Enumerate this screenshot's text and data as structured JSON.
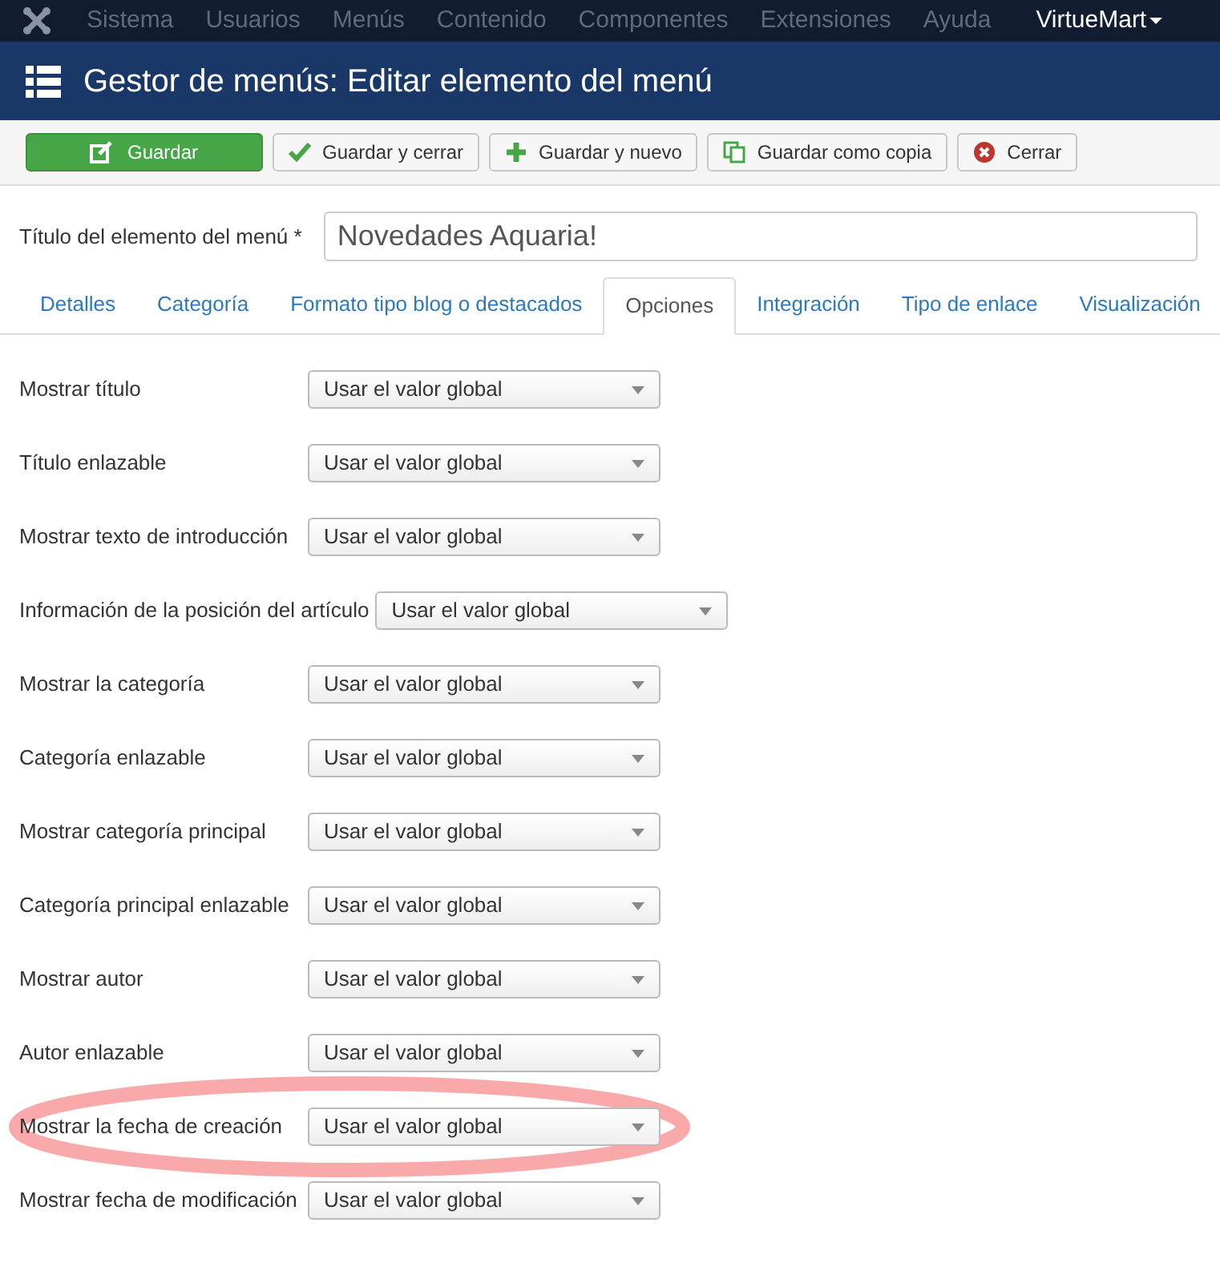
{
  "topnav": {
    "items": [
      "Sistema",
      "Usuarios",
      "Menús",
      "Contenido",
      "Componentes",
      "Extensiones",
      "Ayuda"
    ],
    "extra": "VirtueMart"
  },
  "header": {
    "title": "Gestor de menús: Editar elemento del menú"
  },
  "toolbar": [
    {
      "kind": "primary",
      "label": "Guardar"
    },
    {
      "kind": "default",
      "label": "Guardar y cerrar"
    },
    {
      "kind": "default",
      "label": "Guardar y nuevo"
    },
    {
      "kind": "default",
      "label": "Guardar como copia"
    },
    {
      "kind": "default",
      "label": "Cerrar"
    }
  ],
  "title_field": {
    "label": "Título del elemento del menú *",
    "value": "Novedades Aquaria!"
  },
  "tabs": [
    {
      "label": "Detalles",
      "selected": false
    },
    {
      "label": "Categoría",
      "selected": false
    },
    {
      "label": "Formato tipo blog o destacados",
      "selected": false
    },
    {
      "label": "Opciones",
      "selected": true
    },
    {
      "label": "Integración",
      "selected": false
    },
    {
      "label": "Tipo de enlace",
      "selected": false
    },
    {
      "label": "Visualización",
      "selected": false
    }
  ],
  "options": [
    {
      "label": "Mostrar título",
      "value": "Usar el valor global",
      "highlighted": false
    },
    {
      "label": "Título enlazable",
      "value": "Usar el valor global",
      "highlighted": false
    },
    {
      "label": "Mostrar texto de introducción",
      "value": "Usar el valor global",
      "highlighted": false
    },
    {
      "label": "Información de la posición del artículo",
      "value": "Usar el valor global",
      "highlighted": false
    },
    {
      "label": "Mostrar la categoría",
      "value": "Usar el valor global",
      "highlighted": false
    },
    {
      "label": "Categoría enlazable",
      "value": "Usar el valor global",
      "highlighted": false
    },
    {
      "label": "Mostrar categoría principal",
      "value": "Usar el valor global",
      "highlighted": false
    },
    {
      "label": "Categoría principal enlazable",
      "value": "Usar el valor global",
      "highlighted": false
    },
    {
      "label": "Mostrar autor",
      "value": "Usar el valor global",
      "highlighted": false
    },
    {
      "label": "Autor enlazable",
      "value": "Usar el valor global",
      "highlighted": false
    },
    {
      "label": "Mostrar la fecha de creación",
      "value": "Usar el valor global",
      "highlighted": true
    },
    {
      "label": "Mostrar fecha de modificación",
      "value": "Usar el valor global",
      "highlighted": false
    }
  ]
}
